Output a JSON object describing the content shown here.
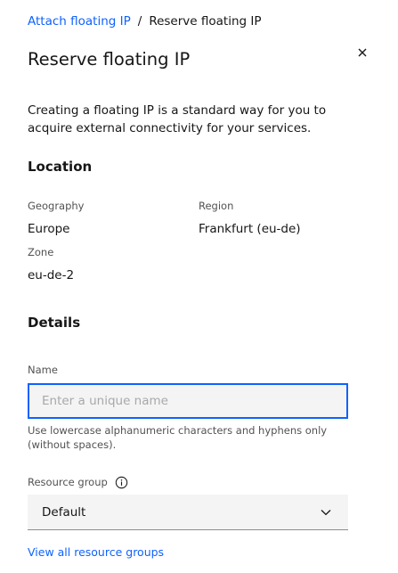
{
  "colors": {
    "link": "#0f62fe",
    "focus": "#0f62fe",
    "text": "#161616",
    "muted": "#525252",
    "field_bg": "#f4f4f4"
  },
  "breadcrumb": {
    "parent_label": "Attach floating IP",
    "separator": "/",
    "current_label": "Reserve floating IP"
  },
  "header": {
    "title": "Reserve floating IP",
    "close_icon": "close-icon"
  },
  "description": "Creating a floating IP is a standard way for you to acquire external connectivity for your services.",
  "location": {
    "section_title": "Location",
    "geography_label": "Geography",
    "geography_value": "Europe",
    "region_label": "Region",
    "region_value": "Frankfurt (eu-de)",
    "zone_label": "Zone",
    "zone_value": "eu-de-2"
  },
  "details": {
    "section_title": "Details",
    "name_label": "Name",
    "name_value": "",
    "name_placeholder": "Enter a unique name",
    "name_helper": "Use lowercase alphanumeric characters and hyphens only (without spaces).",
    "resource_group_label": "Resource group",
    "resource_group_info_icon": "info-icon",
    "resource_group_selected": "Default",
    "resource_group_chevron_icon": "chevron-down-icon",
    "view_all_link": "View all resource groups"
  }
}
